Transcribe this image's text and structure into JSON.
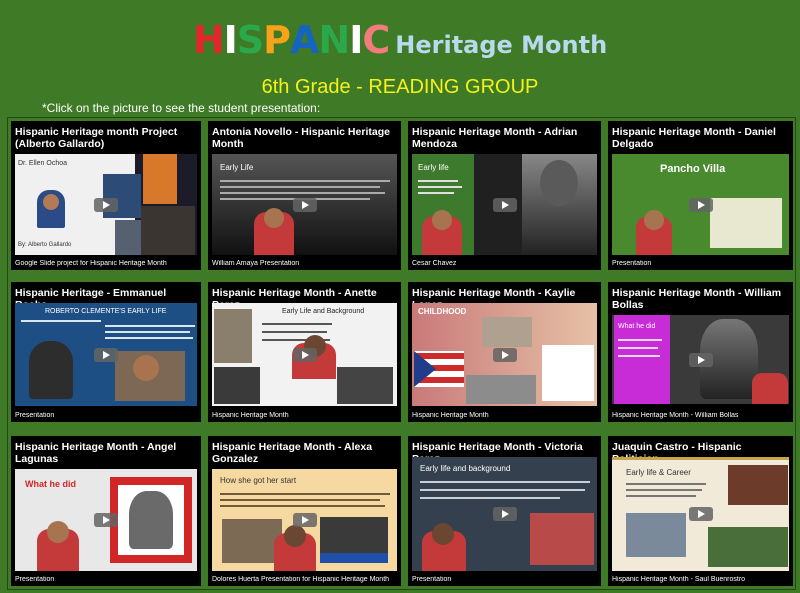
{
  "header": {
    "hispanic_letters": [
      {
        "ch": "H",
        "color": "#e3262b"
      },
      {
        "ch": "I",
        "color": "#ffffff"
      },
      {
        "ch": "S",
        "color": "#2aa84a"
      },
      {
        "ch": "P",
        "color": "#f6a21a"
      },
      {
        "ch": "A",
        "color": "#1565c0"
      },
      {
        "ch": "N",
        "color": "#2aa84a"
      },
      {
        "ch": "I",
        "color": "#ffffff"
      },
      {
        "ch": "C",
        "color": "#f37b7b"
      }
    ],
    "title_rest": "Heritage Month",
    "subtitle": "6th Grade - READING GROUP",
    "instruction": "*Click on the picture to see the student presentation:"
  },
  "cards": [
    {
      "title": "Hispanic Heritage month Project (Alberto Gallardo)",
      "caption": "Google Slide project for Hispanic Heritage Month",
      "slide_name": "Dr. Ellen Ochoa",
      "slide_author": "By: Alberto Gallardo"
    },
    {
      "title": "Antonia Novello - Hispanic Heritage Month",
      "caption": "William Amaya Presentation",
      "slide_heading": "Early Life"
    },
    {
      "title": "Hispanic Heritage Month - Adrian Mendoza",
      "caption": "Cesar Chavez",
      "slide_heading": "Early life"
    },
    {
      "title": "Hispanic Heritage Month - Daniel Delgado",
      "caption": "Presentation",
      "slide_heading": "Pancho Villa"
    },
    {
      "title": "Hispanic Heritage - Emmanuel Rocha",
      "caption": "Presentation",
      "slide_heading": "ROBERTO CLEMENTE'S EARLY LIFE"
    },
    {
      "title": "Hispanic Heritage Month - Anette Perez",
      "caption": "Hispanic Heritage Month",
      "slide_heading": "Early Life and Background"
    },
    {
      "title": "Hispanic Heritage Month - Kaylie Lopez",
      "caption": "Hispanic Heritage Month",
      "slide_heading": "CHILDHOOD"
    },
    {
      "title": "Hispanic Heritage Month - William Bollas",
      "caption": "Hispanic Heritage Month - William Bollas",
      "slide_heading": "What he did"
    },
    {
      "title": "Hispanic Heritage Month - Angel Lagunas",
      "caption": "Presentation",
      "slide_heading": "What he did"
    },
    {
      "title": "Hispanic Heritage Month - Alexa Gonzalez",
      "caption": "Dolores Huerta Presentation for Hispanic Heritage Month",
      "slide_heading": "How she got her start"
    },
    {
      "title": "Hispanic Heritage Month - Victoria Perez",
      "caption": "Presentation",
      "slide_heading": "Early life and background"
    },
    {
      "title": "Juaquin Castro - Hispanic Politician",
      "caption": "Hispanic Heritage Month - Saul Buenrostro",
      "slide_heading": "Early life & Career"
    }
  ]
}
